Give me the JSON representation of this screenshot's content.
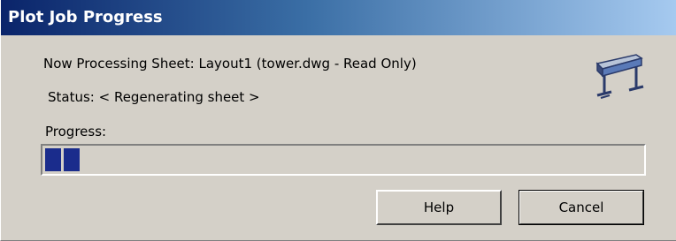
{
  "window": {
    "title": "Plot Job Progress"
  },
  "body": {
    "processing_text": "Now Processing Sheet: Layout1 (tower.dwg - Read Only)",
    "status_text": "Status: < Regenerating sheet >",
    "progress_label": "Progress:"
  },
  "progress": {
    "value_percent": 6,
    "blocks": 2,
    "fill_color": "#1a2c8c"
  },
  "buttons": {
    "help_label": "Help",
    "cancel_label": "Cancel"
  },
  "icons": {
    "plotter": "plotter-icon"
  },
  "colors": {
    "title_gradient_start": "#0a246a",
    "title_gradient_end": "#a6caf0",
    "dialog_bg": "#d4d0c8"
  }
}
